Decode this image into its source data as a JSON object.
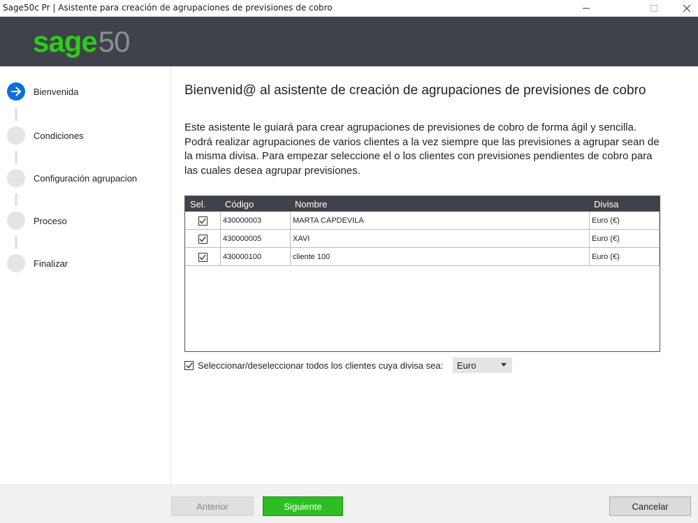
{
  "window": {
    "title": "Sage50c Pr | Asistente para creación de agrupaciones de previsiones de cobro"
  },
  "brand": {
    "logo_text": "sage",
    "logo_number": "50",
    "logo_color": "#2ecc1b"
  },
  "steps": [
    {
      "label": "Bienvenida",
      "state": "active",
      "icon": "arrow-right-icon"
    },
    {
      "label": "Condiciones",
      "state": "pending"
    },
    {
      "label": "Configuración agrupacion",
      "state": "pending"
    },
    {
      "label": "Proceso",
      "state": "pending"
    },
    {
      "label": "Finalizar",
      "state": "pending"
    }
  ],
  "main": {
    "heading": "Bienvenid@ al asistente de creación de agrupaciones de previsiones de cobro",
    "intro": "Este asistente le guiará para crear agrupaciones de previsiones de cobro de forma ágil y sencilla. Podrá realizar agrupaciones de varios clientes a la vez siempre que las previsiones a agrupar sean de la misma divisa. Para empezar seleccione el o los clientes con previsiones pendientes de cobro para las cuales desea agrupar previsiones."
  },
  "grid": {
    "columns": [
      "Sel.",
      "Código",
      "Nombre",
      "Divisa"
    ],
    "rows": [
      {
        "selected": true,
        "codigo": "430000003",
        "nombre": "MARTA CAPDEVILA",
        "divisa": "Euro (€)"
      },
      {
        "selected": true,
        "codigo": "430000005",
        "nombre": "XAVI",
        "divisa": "Euro (€)"
      },
      {
        "selected": true,
        "codigo": "430000100",
        "nombre": "cliente 100",
        "divisa": "Euro (€)"
      }
    ]
  },
  "select_all": {
    "checked": true,
    "label": "Seleccionar/deseleccionar todos los clientes cuya divisa sea:",
    "currency_value": "Euro"
  },
  "footer": {
    "prev_label": "Anterior",
    "next_label": "Siguiente",
    "cancel_label": "Cancelar"
  }
}
